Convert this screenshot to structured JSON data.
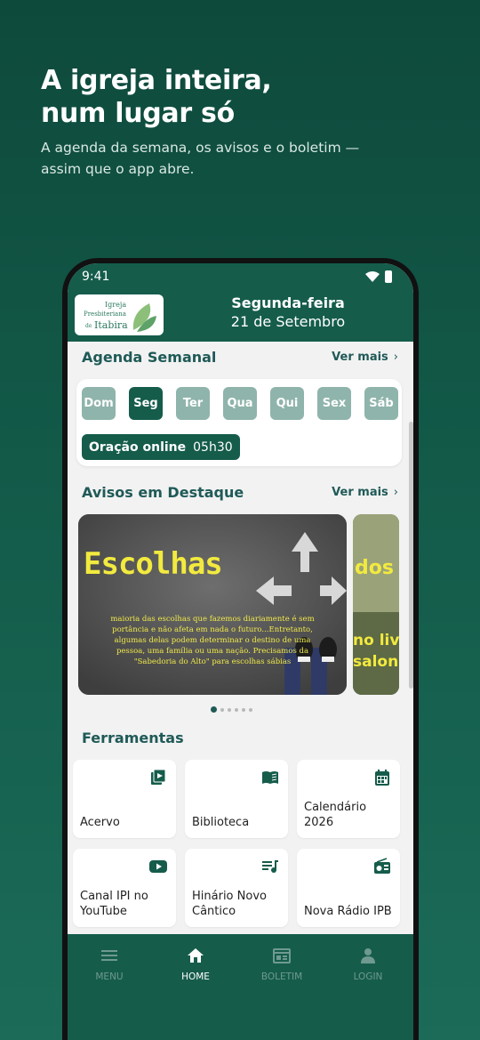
{
  "promo": {
    "title": "A igreja inteira,\nnum lugar só",
    "subtitle": "A agenda da semana, os avisos e o boletim —\nassim que o app abre."
  },
  "status_bar": {
    "time": "9:41"
  },
  "header": {
    "logo": {
      "line1": "Igreja",
      "line2": "Presbiteriana",
      "line3": "Itabira",
      "prefix": "de"
    },
    "weekday": "Segunda-feira",
    "date": "21 de Setembro"
  },
  "agenda": {
    "title": "Agenda Semanal",
    "see_more": "Ver mais",
    "days": [
      "Dom",
      "Seg",
      "Ter",
      "Qua",
      "Qui",
      "Sex",
      "Sáb"
    ],
    "selected_day": "Seg",
    "event": {
      "name": "Oração online",
      "time": "05h30"
    }
  },
  "notices": {
    "title": "Avisos em Destaque",
    "see_more": "Ver mais",
    "banner": {
      "title": "Escolhas",
      "body": "maioria das escolhas que fazemos diariamente é sem\nportância e não afeta em nada o futuro...Entretanto,\nalgumas delas podem determinar o destino de uma\npessoa, uma família ou uma nação. Precisamos da\n\"Sabedoria do Alto\" para escolhas sábias"
    },
    "banner2": {
      "title": "dos T",
      "line1": "no livr",
      "line2": "salonic"
    },
    "pages": 6,
    "current_page": 1
  },
  "tools": {
    "title": "Ferramentas",
    "items": [
      {
        "label": "Acervo",
        "icon": "video-library-icon"
      },
      {
        "label": "Biblioteca",
        "icon": "book-icon"
      },
      {
        "label": "Calendário\n2026",
        "icon": "calendar-icon"
      },
      {
        "label": "Canal IPI no\nYouTube",
        "icon": "youtube-icon"
      },
      {
        "label": "Hinário Novo\nCântico",
        "icon": "music-list-icon"
      },
      {
        "label": "Nova Rádio IPB",
        "icon": "radio-icon"
      }
    ]
  },
  "nav": {
    "items": [
      {
        "label": "MENU",
        "icon": "menu-icon"
      },
      {
        "label": "HOME",
        "icon": "home-icon"
      },
      {
        "label": "BOLETIM",
        "icon": "bulletin-icon"
      },
      {
        "label": "LOGIN",
        "icon": "user-icon"
      }
    ],
    "active": "HOME"
  },
  "colors": {
    "brand_green": "#155c4b",
    "heading_teal": "#1f5a57",
    "day_inactive": "#8fb4ab",
    "banner_yellow": "#f2ea3e"
  }
}
